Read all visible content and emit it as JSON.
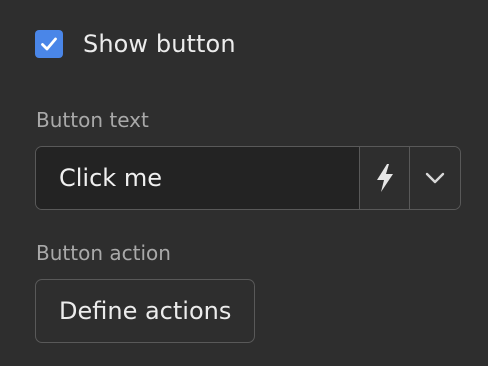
{
  "show_button": {
    "label": "Show button",
    "checked": true,
    "icon": "check-icon",
    "accent_color": "#4a86e8"
  },
  "button_text": {
    "label": "Button text",
    "value": "Click me",
    "bolt_icon": "lightning-bolt-icon",
    "dropdown_icon": "chevron-down-icon"
  },
  "button_action": {
    "label": "Button action",
    "button_label": "Define actions"
  }
}
